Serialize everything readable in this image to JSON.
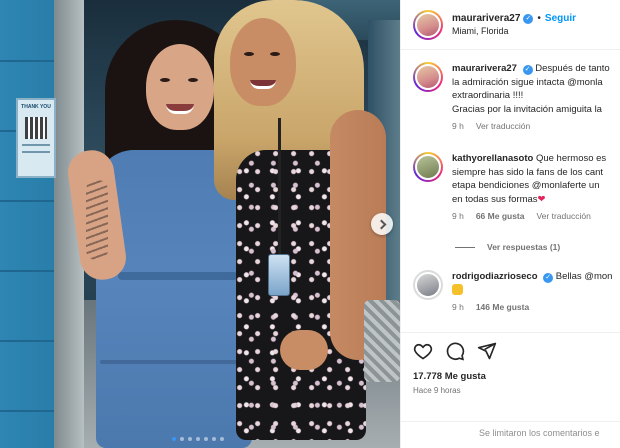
{
  "post": {
    "author": {
      "username": "maurarivera27",
      "follow_label": "Seguir",
      "location": "Miami, Florida"
    },
    "media": {
      "poster_title": "THANK YOU",
      "slide_count": 7,
      "active_slide": 1
    },
    "comments": [
      {
        "username": "maurarivera27",
        "lines": [
          "Después de tanto",
          "la admiración sigue intacta @monla",
          "extraordinaria !!!!",
          "Gracias por la invitación amiguita la"
        ],
        "time": "9 h",
        "translate_label": "Ver traducción",
        "avatar_icon": "avatar-icon"
      },
      {
        "username": "kathyorellanasoto",
        "lines": [
          "Que hermoso es",
          "siempre has sido la fans de los cant",
          "etapa bendiciones @monlaferte un",
          "en todas sus formas"
        ],
        "time": "9 h",
        "likes": "66 Me gusta",
        "translate_label": "Ver traducción",
        "replies_label": "Ver respuestas (1)",
        "emoji": "heart-emoji"
      },
      {
        "username": "rodrigodiazrioseco",
        "lines": [
          "Bellas @mon"
        ],
        "time": "9 h",
        "likes": "146 Me gusta",
        "emoji": "raised-fist-emoji"
      }
    ],
    "actions": {
      "icons": [
        "heart-icon",
        "comment-icon",
        "share-icon"
      ],
      "likes_label": "17.778 Me gusta",
      "time_label": "Hace 9 horas"
    },
    "footer": "Se limitaron los comentarios e",
    "colors": {
      "link_blue": "#0095f6",
      "verified_blue": "#3897f0",
      "mention_blue": "#00376b",
      "muted_gray": "#737373"
    }
  }
}
